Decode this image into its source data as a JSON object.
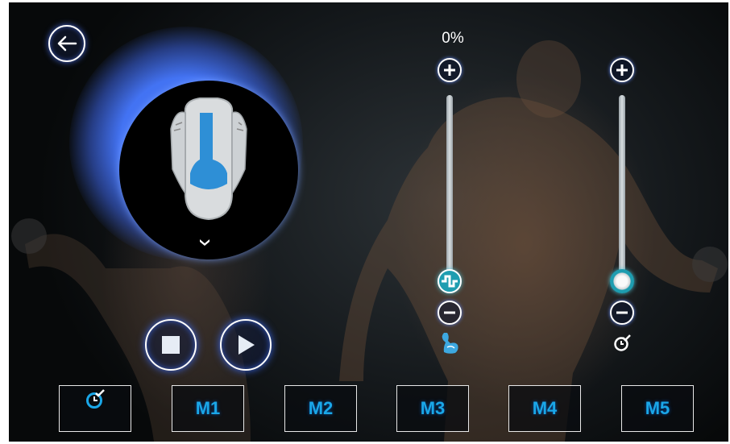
{
  "header": {
    "back_icon": "arrow-left-circle-icon"
  },
  "body_map": {
    "zone_color": "#2e8fd6",
    "expand_icon": "chevron-down-icon"
  },
  "playback": {
    "stop_icon": "stop-icon",
    "play_icon": "play-icon"
  },
  "intensity": {
    "percent_label": "0%",
    "level_fraction": 0.0,
    "increase_icon": "plus-circle-icon",
    "decrease_icon": "minus-circle-icon",
    "thumb_icon": "pulse-wave-icon",
    "mode_icon": "flexed-bicep-icon"
  },
  "timer": {
    "level_fraction": 0.0,
    "increase_icon": "plus-circle-icon",
    "decrease_icon": "minus-circle-icon",
    "thumb_icon": "circle-knob-icon",
    "mode_icon": "timer-check-icon"
  },
  "modes": [
    {
      "icon": "timer-check-icon",
      "label": ""
    },
    {
      "label": "M1"
    },
    {
      "label": "M2"
    },
    {
      "label": "M3"
    },
    {
      "label": "M4"
    },
    {
      "label": "M5"
    }
  ],
  "colors": {
    "accent": "#1aa7e8",
    "glow": "#4a7bff",
    "background": "#15191c"
  }
}
